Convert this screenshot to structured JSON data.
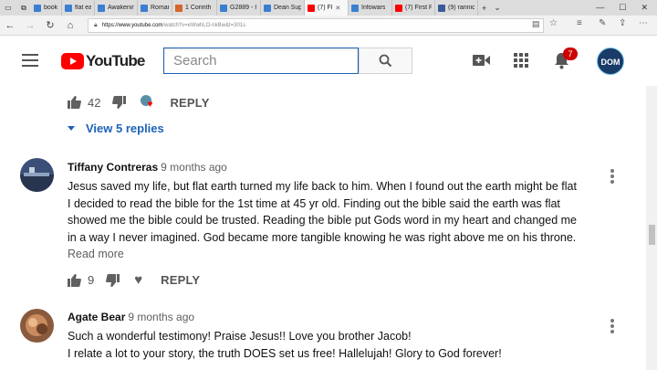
{
  "browser": {
    "tabs": [
      {
        "label": "book of e",
        "favicon_color": "#3a7fd0"
      },
      {
        "label": "flat earth",
        "favicon_color": "#3a7fd0"
      },
      {
        "label": "Awakenir",
        "favicon_color": "#3a7fd0"
      },
      {
        "label": "Romans c",
        "favicon_color": "#3a7fd0"
      },
      {
        "label": "1 Corinth",
        "favicon_color": "#d7642a"
      },
      {
        "label": "G2889 - I",
        "favicon_color": "#3a7fd0"
      },
      {
        "label": "Dean Sup",
        "favicon_color": "#3a7fd0"
      },
      {
        "label": "(7) Fl",
        "favicon_color": "#ff0000",
        "active": true
      },
      {
        "label": "Infowars",
        "favicon_color": "#3a7fd0"
      },
      {
        "label": "(7) First P",
        "favicon_color": "#ff0000"
      },
      {
        "label": "(9) rannic",
        "favicon_color": "#3b5998"
      }
    ],
    "url_host": "https://www.youtube.com",
    "url_path": "/watch?v=eWwhLO-nkBw&t=301s"
  },
  "header": {
    "logo_text": "YouTube",
    "search_placeholder": "Search",
    "notification_count": "7",
    "avatar_text": "DOM"
  },
  "top_actions": {
    "like_count": "42",
    "reply_label": "REPLY",
    "view_replies_label": "View 5 replies"
  },
  "comments": [
    {
      "author": "Tiffany Contreras",
      "time": "9 months ago",
      "lines": [
        "Jesus saved my life, but flat earth turned my life back to him. When I found out the earth might be flat",
        "I decided to read the bible for the 1st time at 45 yr old. Finding out the bible said the earth was flat",
        "showed me the bible could be trusted. Reading the bible put Gods word in my heart and changed me",
        "in a way I never imagined. God became more tangible knowing he was right above me on his throne."
      ],
      "read_more": "Read more",
      "likes": "9",
      "reply_label": "REPLY"
    },
    {
      "author": "Agate Bear",
      "time": "9 months ago",
      "lines": [
        "Such a wonderful testimony! Praise Jesus!! Love you brother Jacob!",
        "I relate a lot to your story, the truth DOES set us free! Hallelujah! Glory to God forever!"
      ]
    }
  ],
  "colors": {
    "youtube_red": "#ff0000",
    "link_blue": "#1c62b9"
  }
}
